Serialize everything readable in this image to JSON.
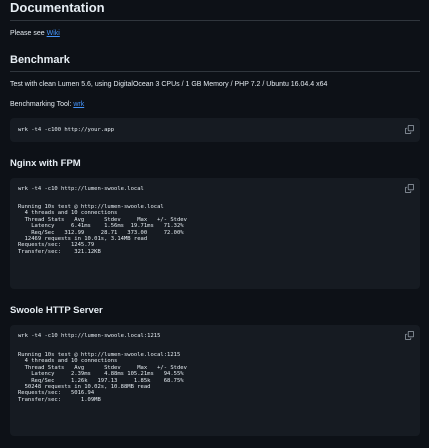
{
  "documentation": {
    "heading": "Documentation",
    "text_prefix": "Please see",
    "link": "Wiki"
  },
  "benchmark": {
    "heading": "Benchmark",
    "description": "Test with clean Lumen 5.6, using DigitalOcean 3 CPUs / 1 GB Memory / PHP 7.2 / Ubuntu 16.04.4 x64",
    "tool_prefix": "Benchmarking Tool:",
    "tool_link": "wrk",
    "command": "wrk -t4 -c100 http://your.app"
  },
  "nginx": {
    "heading": "Nginx with FPM",
    "command": "wrk -t4 -c10 http://lumen-swoole.local",
    "output": "Running 10s test @ http://lumen-swoole.local\n  4 threads and 10 connections\n  Thread Stats   Avg      Stdev     Max   +/- Stdev\n    Latency     6.41ms    1.56ms  19.71ms   71.32%\n    Req/Sec   312.99     28.71   373.00     72.00%\n  12469 requests in 10.01s, 3.14MB read\nRequests/sec:   1245.79\nTransfer/sec:    321.12KB"
  },
  "swoole": {
    "heading": "Swoole HTTP Server",
    "command": "wrk -t4 -c10 http://lumen-swoole.local:1215",
    "output": "Running 10s test @ http://lumen-swoole.local:1215\n  4 threads and 10 connections\n  Thread Stats   Avg      Stdev     Max   +/- Stdev\n    Latency     2.39ms    4.88ms 105.21ms   94.55%\n    Req/Sec     1.26k   197.13     1.85k    68.75%\n  50248 requests in 10.02s, 10.88MB read\nRequests/sec:   5016.94\nTransfer/sec:      1.09MB"
  },
  "icons": {
    "copy": "copy-icon"
  }
}
